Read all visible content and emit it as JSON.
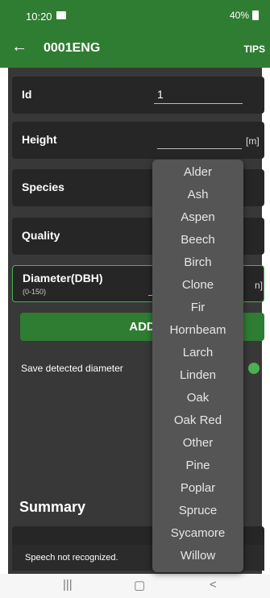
{
  "status_bar": {
    "time": "10:20",
    "right": "40%"
  },
  "toolbar": {
    "title": "0001ENG",
    "tips_label": "TIPS",
    "back_icon": "arrow-left-icon"
  },
  "form": {
    "id_label": "Id",
    "id_value": "1",
    "height_label": "Height",
    "height_unit": "[m]",
    "species_label": "Species",
    "quality_label": "Quality",
    "diameter_label": "Diameter(DBH)",
    "diameter_range": "(0-150)",
    "diameter_unit": "n]"
  },
  "add_button_label": "ADD",
  "save_detected_label": "Save detected diameter",
  "summary_title": "Summary",
  "snackbar_text": "Speech not recognized.",
  "nav": {
    "recent": "|||",
    "home": "▢",
    "back": "<"
  },
  "dropdown": {
    "items": [
      "Alder",
      "Ash",
      "Aspen",
      "Beech",
      "Birch",
      "Clone",
      "Fir",
      "Hornbeam",
      "Larch",
      "Linden",
      "Oak",
      "Oak Red",
      "Other",
      "Pine",
      "Poplar",
      "Spruce",
      "Sycamore",
      "Willow"
    ]
  },
  "colors": {
    "primary": "#2f7d32",
    "accent": "#4caf50"
  }
}
